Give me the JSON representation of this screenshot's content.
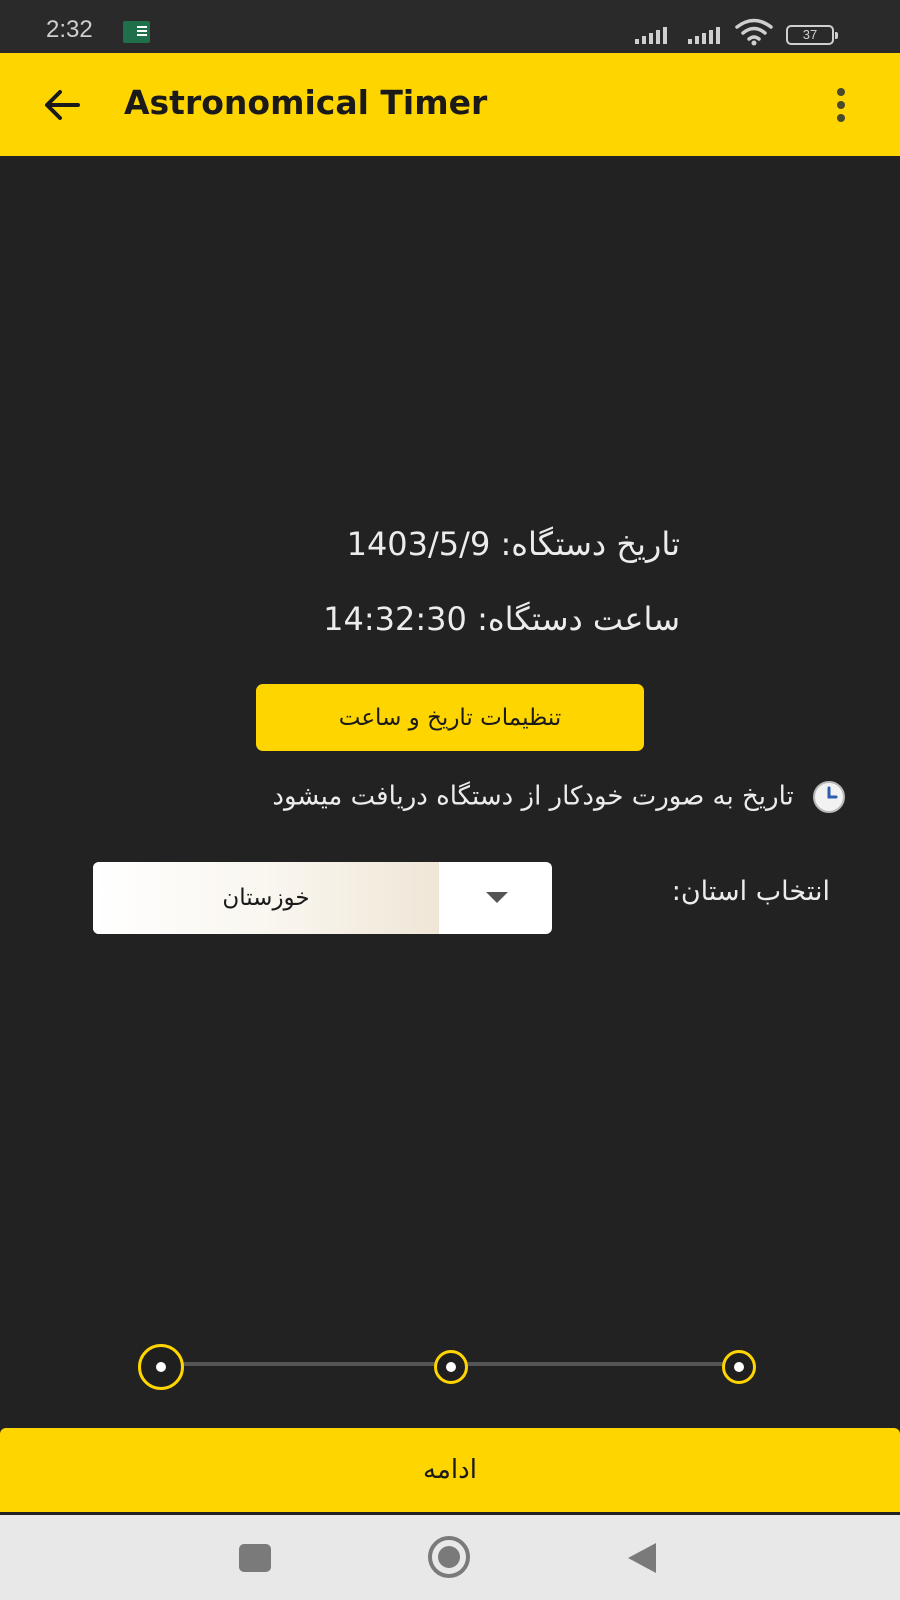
{
  "status_bar": {
    "time": "2:32",
    "battery": "37"
  },
  "app_bar": {
    "title": "Astronomical Timer"
  },
  "device_info": {
    "date_line": "تاریخ دستگاه: 1403/5/9",
    "time_line": "ساعت دستگاه: 14:32:30"
  },
  "settings_button": {
    "label": "تنظیمات تاریخ و ساعت"
  },
  "auto_note": {
    "text": "تاریخ به صورت خودکار از دستگاه دریافت میشود"
  },
  "province": {
    "label": "انتخاب استان:",
    "selected": "خوزستان"
  },
  "stepper": {
    "total_steps": 3,
    "current_step": 1
  },
  "continue_button": {
    "label": "ادامه"
  },
  "colors": {
    "accent": "#ffd500",
    "background": "#222222",
    "text": "#ececec"
  },
  "icons": {
    "back": "arrow-left-icon",
    "more": "more-vertical-icon",
    "clock": "clock-icon",
    "dropdown": "chevron-down-icon"
  }
}
